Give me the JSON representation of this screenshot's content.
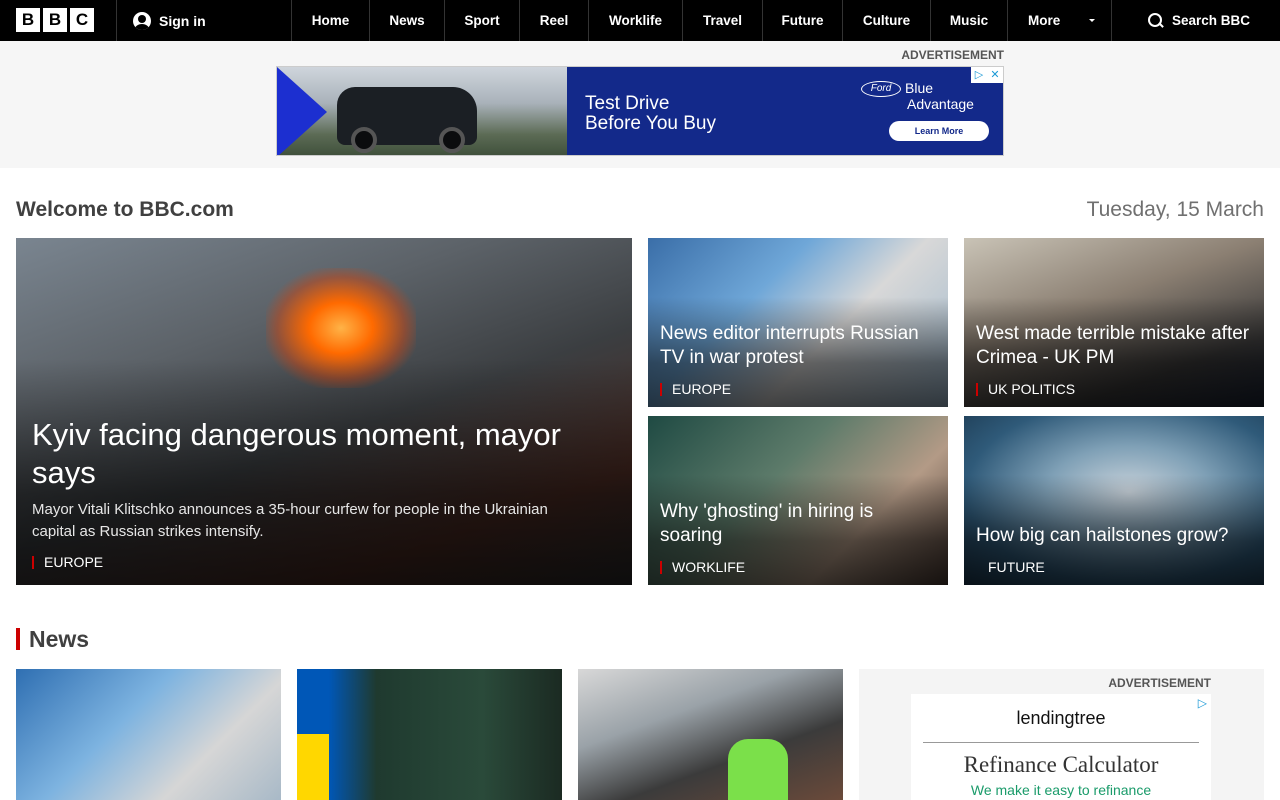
{
  "header": {
    "logo_letters": [
      "B",
      "B",
      "C"
    ],
    "signin_label": "Sign in",
    "nav": [
      "Home",
      "News",
      "Sport",
      "Reel",
      "Worklife",
      "Travel",
      "Future",
      "Culture",
      "Music"
    ],
    "more_label": "More",
    "search_label": "Search BBC"
  },
  "top_ad": {
    "label": "ADVERTISEMENT",
    "headline_1": "Test Drive",
    "headline_2": "Before You Buy",
    "brand_logo": "Ford",
    "brand_1": "Blue",
    "brand_2": "Advantage",
    "cta": "Learn More"
  },
  "welcome": {
    "title": "Welcome to BBC.com",
    "date": "Tuesday, 15 March"
  },
  "hero": {
    "title": "Kyiv facing dangerous moment, mayor says",
    "summary": "Mayor Vitali Klitschko announces a 35-hour curfew for people in the Ukrainian capital as Russian strikes intensify.",
    "tag": "EUROPE"
  },
  "cards": [
    {
      "title": "News editor interrupts Russian TV in war protest",
      "tag": "EUROPE"
    },
    {
      "title": "West made terrible mistake after Crimea - UK PM",
      "tag": "UK POLITICS"
    },
    {
      "title": "Why 'ghosting' in hiring is soaring",
      "tag": "WORKLIFE"
    },
    {
      "title": "How big can hailstones grow?",
      "tag": "FUTURE"
    }
  ],
  "news_section": {
    "title": "News"
  },
  "bottom_ad": {
    "label": "ADVERTISEMENT",
    "brand": "lendingtree",
    "title": "Refinance Calculator",
    "subtitle": "We make it easy to refinance"
  },
  "icons": {
    "account": "user-circle-icon",
    "search": "magnifier-icon",
    "more": "caret-down-icon",
    "ad_choices": "ad-choices-icon"
  },
  "colors": {
    "nav_bg": "#000000",
    "accent_red": "#cc0000",
    "ad_blue": "#13298a"
  }
}
